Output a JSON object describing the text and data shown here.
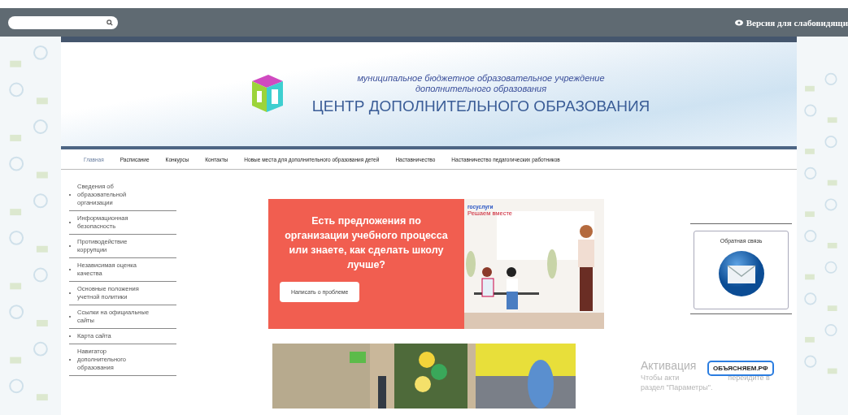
{
  "top_bar": {
    "search": {
      "kind": "search"
    },
    "accessibility_link": "Версия для слабовидящи"
  },
  "header": {
    "subtitle_lines": [
      "муниципальное бюджетное образовательное учреждение",
      "дополнительного образования"
    ],
    "title": "ЦЕНТР ДОПОЛНИТЕЛЬНОГО ОБРАЗОВАНИЯ"
  },
  "nav": [
    {
      "label": "Главная",
      "selected": true
    },
    {
      "label": "Расписание",
      "selected": false
    },
    {
      "label": "Конкурсы",
      "selected": false
    },
    {
      "label": "Контакты",
      "selected": false
    },
    {
      "label": "Новые места для дополнительного образования детей",
      "selected": false
    },
    {
      "label": "Наставничество",
      "selected": false
    },
    {
      "label": "Наставничество педагогических работников",
      "selected": false
    }
  ],
  "sidebar": {
    "items": [
      "Сведения об образовательной организации",
      "Информационная безопасность",
      "Противодействие коррупции",
      "Независимая оценка качества",
      "Основные положения учетной политики",
      "Ссылки на официальные сайты",
      "Карта сайта",
      "Навигатор дополнительного образования"
    ]
  },
  "promo": {
    "heading": "Есть предложения по организации учебного процесса или знаете, как сделать школу лучше?",
    "button": "Написать о проблеме",
    "brand": "госуслуги",
    "brand_tagline": "Решаем вместе"
  },
  "feedback": {
    "title": "Обратная связь"
  },
  "activation_notice": {
    "title": "Активация",
    "line_start": "Чтобы акти",
    "line_end": "перейдите в",
    "line_2": "раздел \"Параметры\"."
  },
  "badge": {
    "label": "ОБЪЯСНЯЕМ.РФ"
  }
}
